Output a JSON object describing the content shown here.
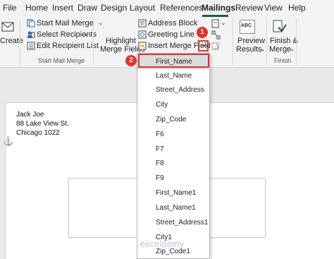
{
  "menu": {
    "items": [
      "File",
      "Home",
      "Insert",
      "Draw",
      "Design",
      "Layout",
      "References",
      "Mailings",
      "Review",
      "View",
      "Help"
    ],
    "active": "Mailings"
  },
  "ribbon": {
    "create_label": "Create",
    "start_mail_merge_group": {
      "start_mail_merge": "Start Mail Merge",
      "select_recipients": "Select Recipients",
      "edit_recipient_list": "Edit Recipient List",
      "group_label": "Start Mail Merge"
    },
    "write_insert_group": {
      "highlight_line1": "Highlight",
      "highlight_line2": "Merge Fields",
      "address_block": "Address Block",
      "greeting_line": "Greeting Line",
      "insert_merge_field": "Insert Merge Field"
    },
    "preview_group": {
      "icon_text": "ABC",
      "line1": "Preview",
      "line2": "Results"
    },
    "finish_group": {
      "line1": "Finish &",
      "line2": "Merge",
      "group_label": "Finish"
    }
  },
  "document": {
    "address_lines": [
      "Jack Joe",
      "88 Lake View St.",
      "Chicago 1022"
    ]
  },
  "merge_fields": {
    "items": [
      "First_Name",
      "Last_Name",
      "Street_Address",
      "City",
      "Zip_Code",
      "F6",
      "F7",
      "F8",
      "F9",
      "First_Name1",
      "Last_Name1",
      "Street_Address1",
      "City1",
      "Zip_Code1"
    ],
    "selected": "First_Name"
  },
  "annotations": {
    "step1": "1",
    "step2": "2"
  },
  "watermark": "exceldemy",
  "colors": {
    "accent": "#1d5e3a",
    "highlight": "#e0332b",
    "selected_bg": "#dcdcdc"
  }
}
